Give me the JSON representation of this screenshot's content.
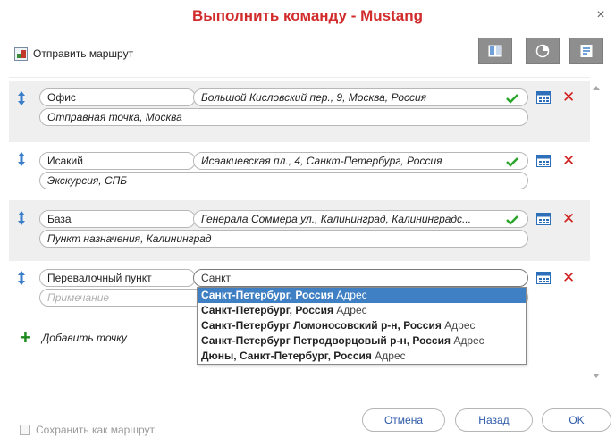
{
  "dialog": {
    "title": "Выполнить команду - Mustang",
    "close_glyph": "×"
  },
  "toolbar": {
    "send_route_label": "Отправить маршрут",
    "icons": [
      "columns-icon",
      "pie-icon",
      "export-icon"
    ]
  },
  "points": [
    {
      "name": "Офис",
      "address": "Большой Кисловский пер., 9, Москва, Россия",
      "note": "Отправная точка, Москва",
      "verified": true
    },
    {
      "name": "Исакий",
      "address": "Исаакиевская пл., 4, Санкт-Петербург, Россия",
      "note": "Экскурсия, СПБ",
      "verified": true
    },
    {
      "name": "База",
      "address": "Генерала Соммера ул., Калининград, Калининградс...",
      "note": "Пункт назначения, Калининград",
      "verified": true
    },
    {
      "name": "Перевалочный пункт",
      "address": "Санкт",
      "note": "",
      "note_placeholder": "Примечание",
      "verified": false
    }
  ],
  "suggestions": [
    {
      "main": "Санкт-Петербург, Россия",
      "suffix": "Адрес",
      "selected": true
    },
    {
      "main": "Санкт-Петербург, Россия",
      "suffix": "Адрес",
      "selected": false
    },
    {
      "main": "Санкт-Петербург Ломоносовский р-н, Россия",
      "suffix": "Адрес",
      "selected": false
    },
    {
      "main": "Санкт-Петербург Петродворцовый р-н, Россия",
      "suffix": "Адрес",
      "selected": false
    },
    {
      "main": "Дюны, Санкт-Петербург, Россия",
      "suffix": "Адрес",
      "selected": false
    }
  ],
  "add_point_label": "Добавить точку",
  "footer": {
    "save_route_label": "Сохранить как маршрут",
    "cancel_label": "Отмена",
    "back_label": "Назад",
    "ok_label": "OK"
  },
  "colors": {
    "title": "#d12b2b",
    "accent_blue": "#2d5aa8",
    "selection": "#3f7fc4",
    "delete_red": "#d12020",
    "check_green": "#2aa52a",
    "add_green": "#1c8a1c"
  }
}
